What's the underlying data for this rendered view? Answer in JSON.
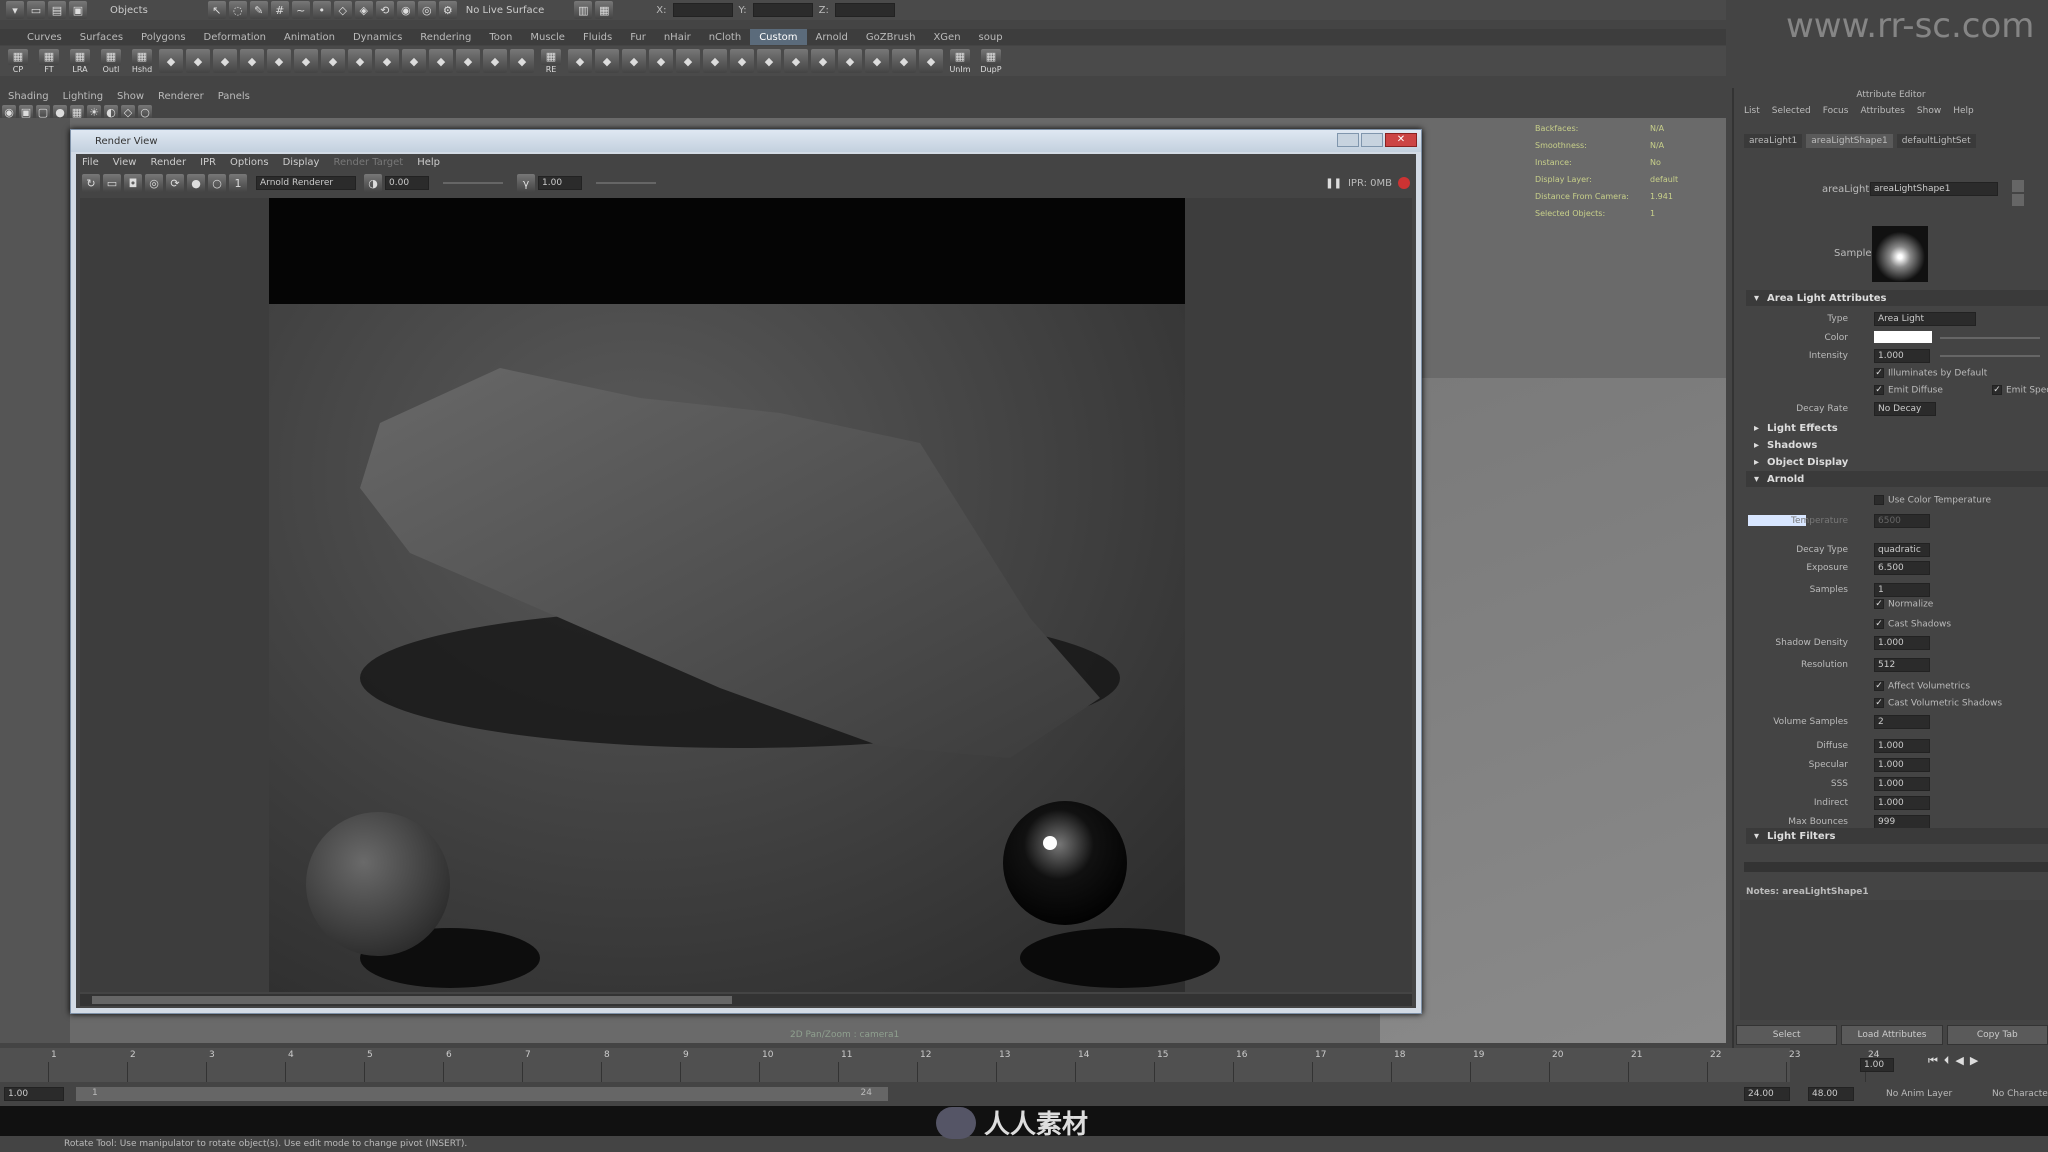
{
  "watermark": "www.rr-sc.com",
  "status_line": {
    "mode_label": "Objects",
    "live_surface": "No Live Surface",
    "x_label": "X:",
    "y_label": "Y:",
    "z_label": "Z:"
  },
  "shelf_tabs": [
    "Curves",
    "Surfaces",
    "Polygons",
    "Deformation",
    "Animation",
    "Dynamics",
    "Rendering",
    "Toon",
    "Muscle",
    "Fluids",
    "Fur",
    "nHair",
    "nCloth",
    "Custom",
    "Arnold",
    "GoZBrush",
    "XGen",
    "soup"
  ],
  "shelf_active": "Custom",
  "shelf_icons": [
    "CP",
    "FT",
    "LRA",
    "Outl",
    "Hshd",
    "RE",
    "UnIm",
    "DupP"
  ],
  "panel_menu": [
    "Shading",
    "Lighting",
    "Show",
    "Renderer",
    "Panels"
  ],
  "hud": [
    {
      "label": "Backfaces:",
      "value": "N/A"
    },
    {
      "label": "Smoothness:",
      "value": "N/A"
    },
    {
      "label": "Instance:",
      "value": "No"
    },
    {
      "label": "Display Layer:",
      "value": "default"
    },
    {
      "label": "Distance From Camera:",
      "value": "1.941"
    },
    {
      "label": "Selected Objects:",
      "value": "1"
    }
  ],
  "camera_label": "2D Pan/Zoom : camera1",
  "render_view": {
    "title": "Render View",
    "menu": [
      "File",
      "View",
      "Render",
      "IPR",
      "Options",
      "Display",
      "Render Target",
      "Help"
    ],
    "renderer": "Arnold Renderer",
    "exposure": "0.00",
    "gamma": "1.00",
    "ipr_status": "IPR: 0MB"
  },
  "attr_editor": {
    "title": "Attribute Editor",
    "menu": [
      "List",
      "Selected",
      "Focus",
      "Attributes",
      "Show",
      "Help"
    ],
    "tabs": [
      "areaLight1",
      "areaLightShape1",
      "defaultLightSet"
    ],
    "node_label": "areaLight:",
    "node_value": "areaLightShape1",
    "sample_label": "Sample",
    "sections": {
      "area": "Area Light Attributes",
      "effects": "Light Effects",
      "shadows": "Shadows",
      "objdisp": "Object Display",
      "arnold": "Arnold",
      "filters": "Light Filters"
    },
    "type_label": "Type",
    "type_value": "Area Light",
    "color_label": "Color",
    "intensity_label": "Intensity",
    "intensity_value": "1.000",
    "illum": "Illuminates by Default",
    "emit_diffuse": "Emit Diffuse",
    "emit_spec": "Emit Spec",
    "decay_label": "Decay Rate",
    "decay_value": "No Decay",
    "use_color_temp": "Use Color Temperature",
    "temperature_label": "Temperature",
    "temperature_value": "6500",
    "arnold_rows": [
      {
        "label": "Decay Type",
        "value": "quadratic"
      },
      {
        "label": "Exposure",
        "value": "6.500"
      },
      {
        "label": "Samples",
        "value": "1"
      }
    ],
    "normalize": "Normalize",
    "cast_shadows": "Cast Shadows",
    "shadow_density_label": "Shadow Density",
    "shadow_density_value": "1.000",
    "resolution_label": "Resolution",
    "resolution_value": "512",
    "affect_vol": "Affect Volumetrics",
    "cast_vol": "Cast Volumetric Shadows",
    "vol_samples_label": "Volume Samples",
    "vol_samples_value": "2",
    "contrib": [
      {
        "label": "Diffuse",
        "value": "1.000"
      },
      {
        "label": "Specular",
        "value": "1.000"
      },
      {
        "label": "SSS",
        "value": "1.000"
      },
      {
        "label": "Indirect",
        "value": "1.000"
      },
      {
        "label": "Max Bounces",
        "value": "999"
      }
    ],
    "notes": "Notes: areaLightShape1",
    "buttons": [
      "Select",
      "Load Attributes",
      "Copy Tab"
    ]
  },
  "timeline": {
    "ticks": [
      "1",
      "2",
      "3",
      "4",
      "5",
      "6",
      "7",
      "8",
      "9",
      "10",
      "11",
      "12",
      "13",
      "14",
      "15",
      "16",
      "17",
      "18",
      "19",
      "20",
      "21",
      "22",
      "23",
      "24"
    ],
    "current": "1.00"
  },
  "range": {
    "start": "1.00",
    "inner_start": "1",
    "inner_end": "24",
    "end": "24.00",
    "end2": "48.00",
    "anim_layer": "No Anim Layer",
    "character": "No Character"
  },
  "help_line": "Rotate Tool: Use manipulator to rotate object(s). Use edit mode to change pivot (INSERT).",
  "logo_text": "人人素材"
}
